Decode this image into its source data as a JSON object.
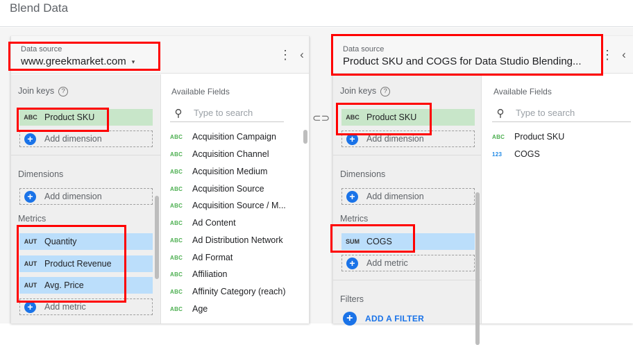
{
  "page": {
    "title": "Blend Data"
  },
  "left_panel": {
    "data_source_label": "Data source",
    "data_source_value": "www.greekmarket.com",
    "caret": "▾",
    "menu_icon": "⋮",
    "collapse_icon": "‹",
    "join_keys_label": "Join keys",
    "help_glyph": "?",
    "join_key": {
      "tag": "ABC",
      "label": "Product SKU"
    },
    "add_dimension_label": "Add dimension",
    "dimensions_label": "Dimensions",
    "metrics_label": "Metrics",
    "metrics": [
      {
        "tag": "AUT",
        "label": "Quantity"
      },
      {
        "tag": "AUT",
        "label": "Product Revenue"
      },
      {
        "tag": "AUT",
        "label": "Avg. Price"
      }
    ],
    "add_metric_label": "Add metric",
    "available_fields_label": "Available Fields",
    "search_placeholder": "Type to search",
    "fields": [
      {
        "tag": "ABC",
        "label": "Acquisition Campaign"
      },
      {
        "tag": "ABC",
        "label": "Acquisition Channel"
      },
      {
        "tag": "ABC",
        "label": "Acquisition Medium"
      },
      {
        "tag": "ABC",
        "label": "Acquisition Source"
      },
      {
        "tag": "ABC",
        "label": "Acquisition Source / M..."
      },
      {
        "tag": "ABC",
        "label": "Ad Content"
      },
      {
        "tag": "ABC",
        "label": "Ad Distribution Network"
      },
      {
        "tag": "ABC",
        "label": "Ad Format"
      },
      {
        "tag": "ABC",
        "label": "Affiliation"
      },
      {
        "tag": "ABC",
        "label": "Affinity Category (reach)"
      },
      {
        "tag": "ABC",
        "label": "Age"
      }
    ]
  },
  "right_panel": {
    "data_source_label": "Data source",
    "data_source_value": "Product SKU and COGS for Data Studio Blending...",
    "menu_icon": "⋮",
    "collapse_icon": "‹",
    "join_keys_label": "Join keys",
    "help_glyph": "?",
    "join_key": {
      "tag": "ABC",
      "label": "Product SKU"
    },
    "add_dimension_label": "Add dimension",
    "dimensions_label": "Dimensions",
    "metrics_label": "Metrics",
    "metrics": [
      {
        "tag": "SUM",
        "label": "COGS"
      }
    ],
    "add_metric_label": "Add metric",
    "filters_label": "Filters",
    "add_filter_label": "ADD A FILTER",
    "available_fields_label": "Available Fields",
    "search_placeholder": "Type to search",
    "fields": [
      {
        "tag": "ABC",
        "label": "Product SKU"
      },
      {
        "tag": "123",
        "label": "COGS"
      }
    ]
  },
  "icons": {
    "search": "search-icon",
    "link": "link-icon",
    "plus": "+",
    "link_glyph": "⊂⊃",
    "search_glyph": "⚲"
  },
  "colors": {
    "highlight": "#ff0000",
    "dimension_chip": "#c8e6c9",
    "metric_chip": "#bbdefb",
    "accent": "#1a73e8"
  }
}
